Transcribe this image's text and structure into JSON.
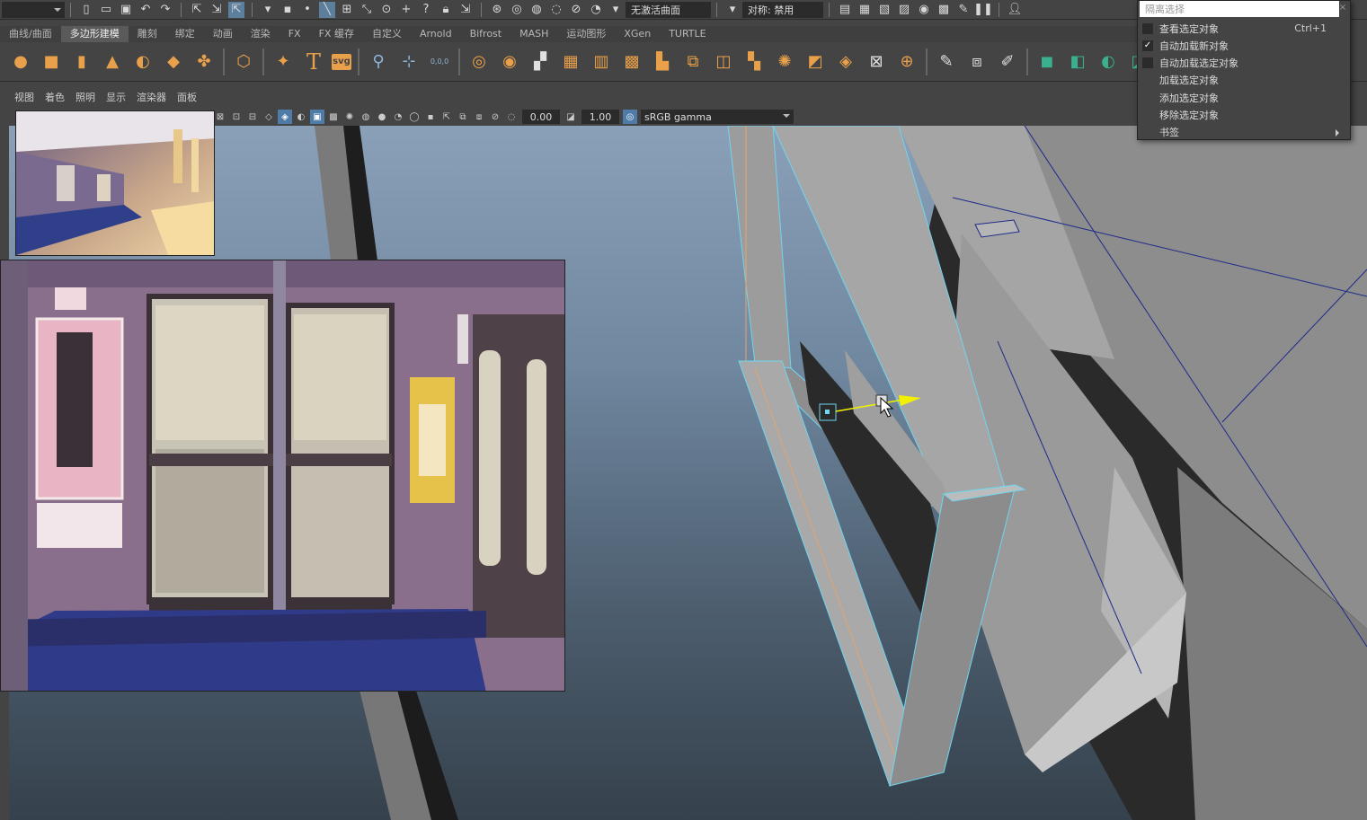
{
  "statusline": {
    "mode_value": "",
    "live_surface": "无激活曲面",
    "symmetry": "对称: 禁用"
  },
  "shelf_tabs": [
    "曲线/曲面",
    "多边形建模",
    "雕刻",
    "绑定",
    "动画",
    "渲染",
    "FX",
    "FX 缓存",
    "自定义",
    "Arnold",
    "Bifrost",
    "MASH",
    "运动图形",
    "XGen",
    "TURTLE"
  ],
  "shelf_tab_active": 1,
  "shelf_icons": [
    "sphere-icon",
    "cube-icon",
    "cylinder-icon",
    "cone-icon",
    "torus-icon",
    "plane-icon",
    "disc-icon",
    "platonic-icon",
    "superellipse-icon",
    "text-icon",
    "svg-icon"
  ],
  "svg_label": "svg",
  "text_label": "T",
  "coord_label": "0,0,0",
  "panel_menu": [
    "视图",
    "着色",
    "照明",
    "显示",
    "渲染器",
    "面板"
  ],
  "viewport_toolbar": {
    "exposure": "0.00",
    "gamma": "1.00",
    "color_space": "sRGB gamma"
  },
  "dropdown": {
    "search_placeholder": "隔离选择",
    "close": "×",
    "items": [
      {
        "label": "查看选定对象",
        "shortcut": "Ctrl+1",
        "checked": false,
        "submenu": false
      },
      {
        "label": "自动加载新对象",
        "shortcut": "",
        "checked": true,
        "submenu": false
      },
      {
        "label": "自动加载选定对象",
        "shortcut": "",
        "checked": false,
        "submenu": false
      },
      {
        "label": "加载选定对象",
        "shortcut": "",
        "checked": null,
        "submenu": false
      },
      {
        "label": "添加选定对象",
        "shortcut": "",
        "checked": null,
        "submenu": false
      },
      {
        "label": "移除选定对象",
        "shortcut": "",
        "checked": null,
        "submenu": false
      },
      {
        "label": "书签",
        "shortcut": "",
        "checked": null,
        "submenu": true
      }
    ]
  },
  "colors": {
    "ui_bg": "#444444",
    "selection_blue": "#5d7f9e",
    "wire_cyan": "#6fd6f0",
    "manipulator_yellow": "#f2f200",
    "shelf_orange": "#e9a04a"
  }
}
